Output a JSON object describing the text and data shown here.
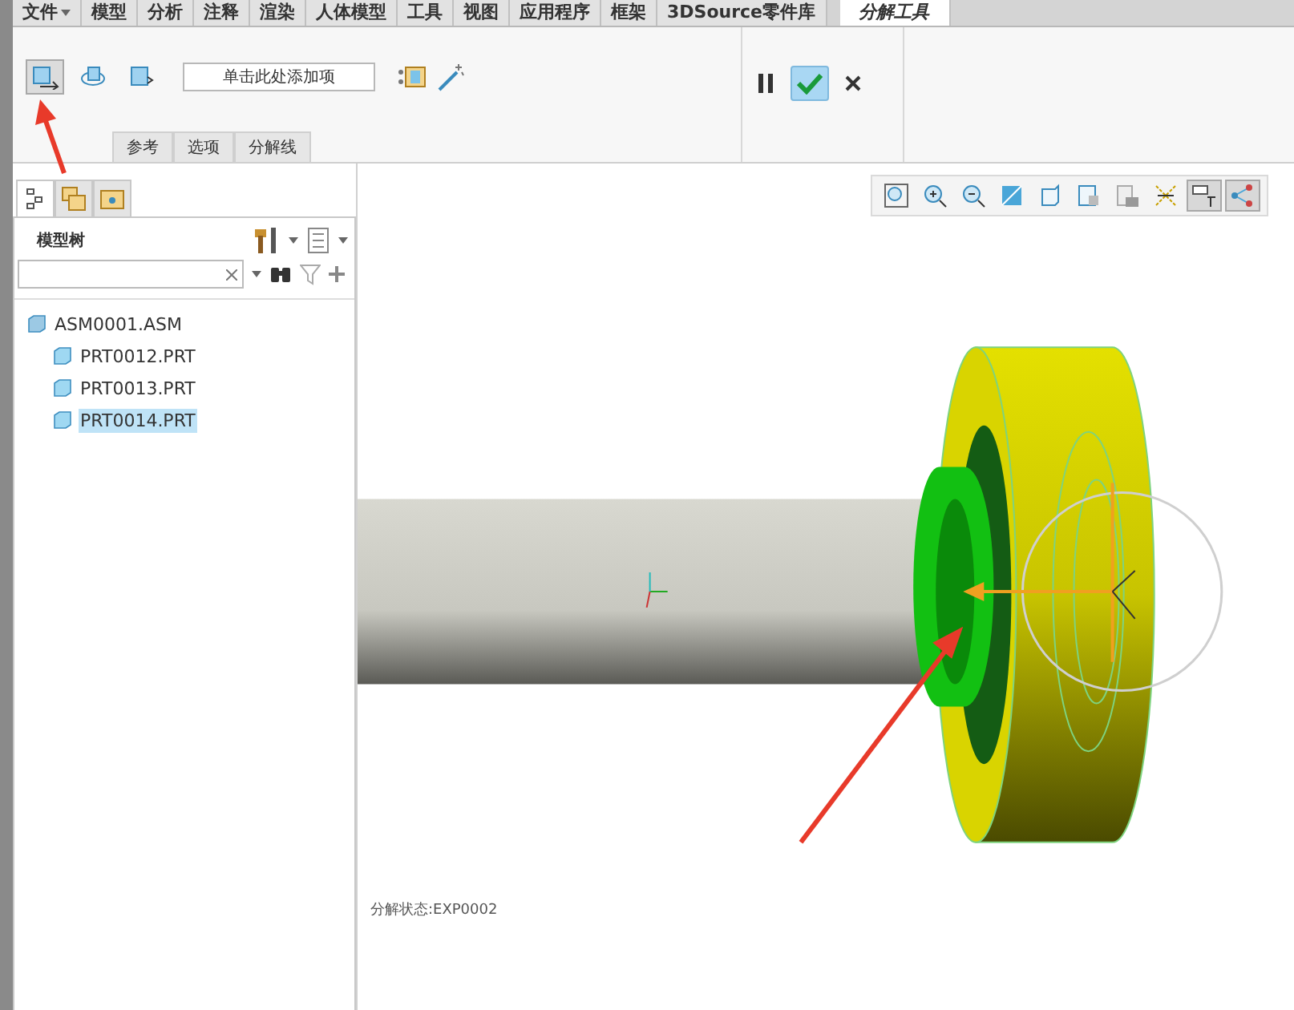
{
  "menu_tabs": [
    {
      "label": "文件",
      "selected": false,
      "dropdown": true
    },
    {
      "label": "模型",
      "selected": false,
      "dropdown": false
    },
    {
      "label": "分析",
      "selected": false,
      "dropdown": false
    },
    {
      "label": "注释",
      "selected": false,
      "dropdown": false
    },
    {
      "label": "渲染",
      "selected": false,
      "dropdown": false
    },
    {
      "label": "人体模型",
      "selected": false,
      "dropdown": false
    },
    {
      "label": "工具",
      "selected": false,
      "dropdown": false
    },
    {
      "label": "视图",
      "selected": false,
      "dropdown": false
    },
    {
      "label": "应用程序",
      "selected": false,
      "dropdown": false
    },
    {
      "label": "框架",
      "selected": false,
      "dropdown": false
    },
    {
      "label": "3DSource零件库",
      "selected": false,
      "dropdown": false
    },
    {
      "label": "分解工具",
      "selected": true,
      "dropdown": false
    }
  ],
  "ribbon": {
    "tools": [
      {
        "kind": "translate",
        "pressed": true
      },
      {
        "kind": "rotate",
        "pressed": false
      },
      {
        "kind": "view",
        "pressed": false
      }
    ],
    "collector": {
      "placeholder": "单击此处添加项"
    },
    "sub_tabs": [
      {
        "label": "参考"
      },
      {
        "label": "选项"
      },
      {
        "label": "分解线"
      }
    ]
  },
  "panel_tabs": [
    {
      "kind": "tree",
      "selected": true
    },
    {
      "kind": "layers",
      "selected": false
    },
    {
      "kind": "folder",
      "selected": false
    }
  ],
  "model_tree": {
    "title": "模型树",
    "items": [
      {
        "label": "ASM0001.ASM",
        "selected": false,
        "children": [
          {
            "label": "PRT0012.PRT",
            "selected": false
          },
          {
            "label": "PRT0013.PRT",
            "selected": false
          },
          {
            "label": "PRT0014.PRT",
            "selected": true
          }
        ]
      }
    ]
  },
  "view_toolbar": [
    {
      "kind": "refit",
      "pressed": false
    },
    {
      "kind": "zoom-in",
      "pressed": false
    },
    {
      "kind": "zoom-out",
      "pressed": false
    },
    {
      "kind": "reorient",
      "pressed": false
    },
    {
      "kind": "display",
      "pressed": false
    },
    {
      "kind": "views",
      "pressed": false
    },
    {
      "kind": "camera",
      "pressed": false
    },
    {
      "kind": "datum",
      "pressed": false
    },
    {
      "kind": "annot",
      "pressed": true
    },
    {
      "kind": "lines",
      "pressed": true
    }
  ],
  "status": "分解状态:EXP0002"
}
